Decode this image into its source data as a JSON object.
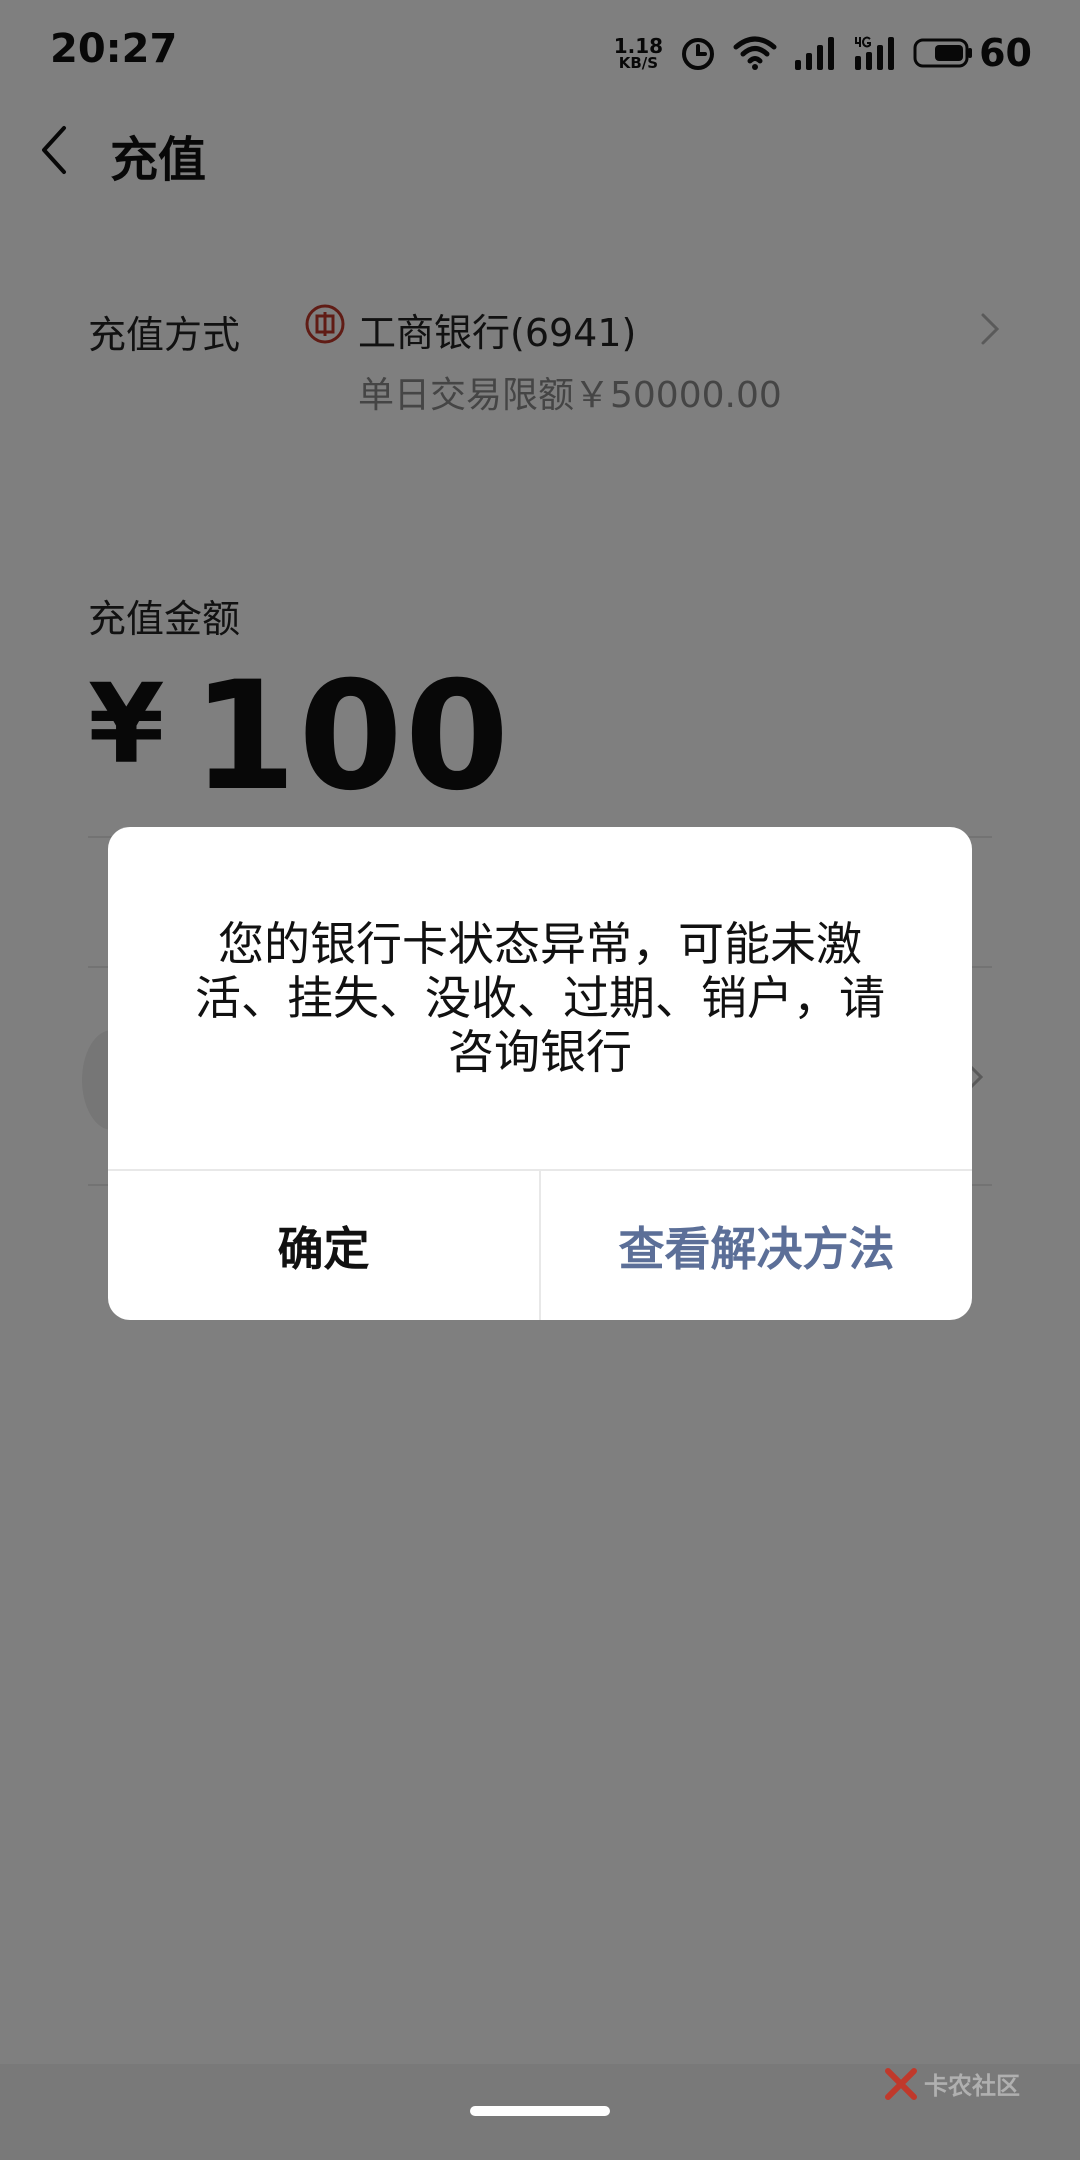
{
  "status_bar": {
    "time": "20:27",
    "net_speed_value": "1.18",
    "net_speed_unit": "KB/S",
    "battery_level": "60",
    "icons": [
      "alarm-icon",
      "wifi-icon",
      "signal-icon",
      "4g-signal-icon",
      "battery-icon"
    ]
  },
  "header": {
    "title": "充值"
  },
  "recharge_method": {
    "label": "充值方式",
    "bank_name": "工商银行(6941)",
    "daily_limit": "单日交易限额￥50000.00",
    "bank_logo_color": "#c0392b"
  },
  "amount": {
    "label": "充值金额",
    "currency_symbol": "¥",
    "value": "100"
  },
  "dialog": {
    "message": "您的银行卡状态异常，可能未激活、挂失、没收、过期、销户，请咨询银行",
    "confirm_label": "确定",
    "solution_label": "查看解决方法",
    "accent_color": "#5c6f98"
  },
  "watermark": {
    "text": "卡农社区"
  }
}
